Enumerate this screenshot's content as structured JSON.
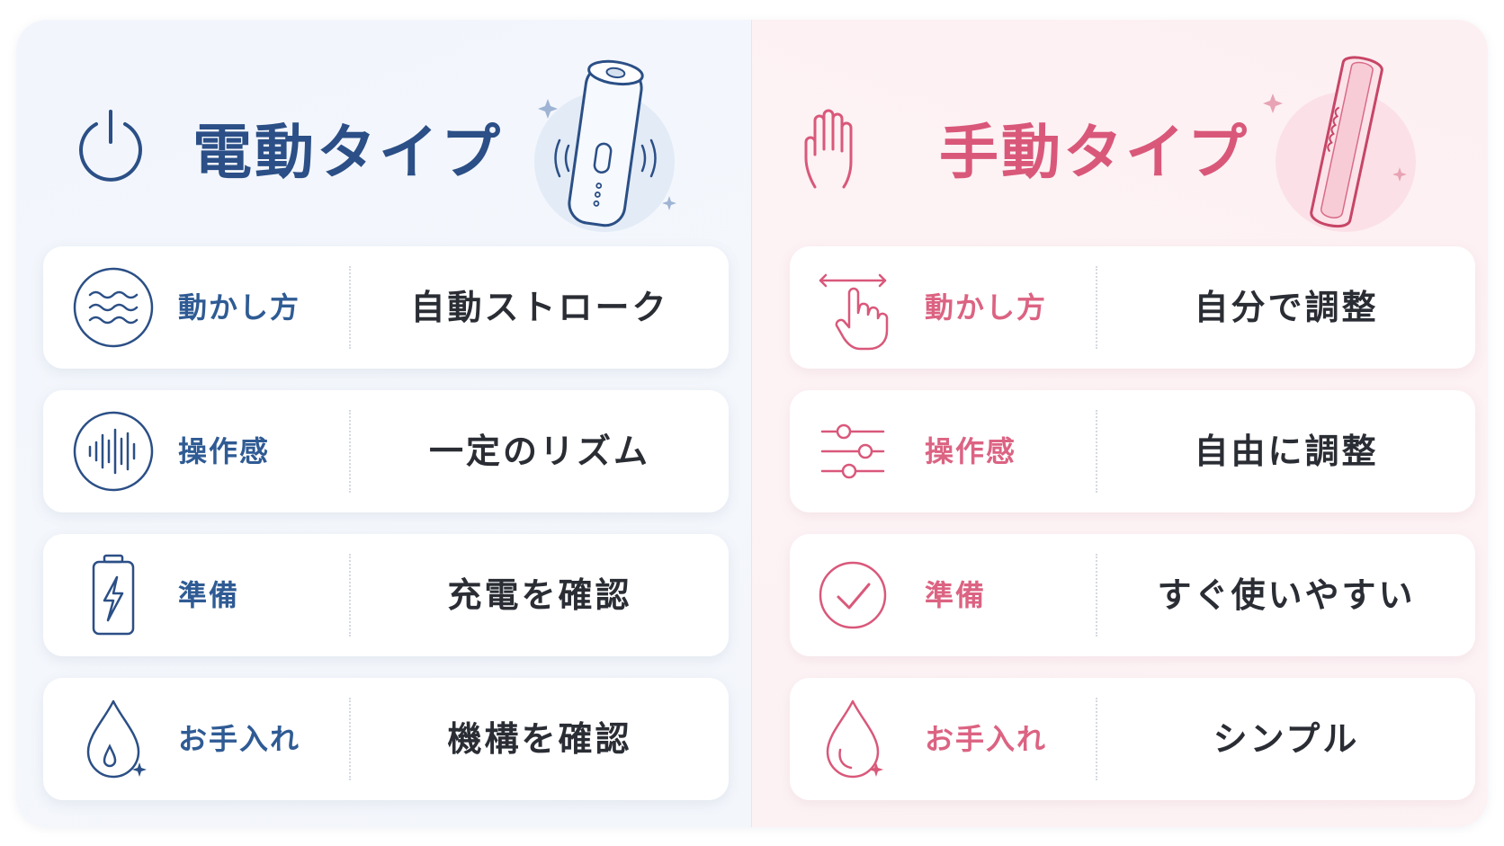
{
  "colors": {
    "electric_accent": "#2b4f86",
    "manual_accent": "#d9587a",
    "value_text": "#2a2d34"
  },
  "electric": {
    "title": "電動タイプ",
    "header_icon": "power-icon",
    "device_icon": "electric-stroker-device-icon",
    "rows": [
      {
        "icon": "wave-lines-icon",
        "label": "動かし方",
        "value": "自動ストローク"
      },
      {
        "icon": "sound-wave-icon",
        "label": "操作感",
        "value": "一定のリズム"
      },
      {
        "icon": "battery-charge-icon",
        "label": "準備",
        "value": "充電を確認"
      },
      {
        "icon": "water-drop-icon",
        "label": "お手入れ",
        "value": "機構を確認"
      }
    ]
  },
  "manual": {
    "title": "手動タイプ",
    "header_icon": "hand-icon",
    "device_icon": "manual-sleeve-device-icon",
    "rows": [
      {
        "icon": "swipe-hand-icon",
        "label": "動かし方",
        "value": "自分で調整"
      },
      {
        "icon": "sliders-icon",
        "label": "操作感",
        "value": "自由に調整"
      },
      {
        "icon": "check-circle-icon",
        "label": "準備",
        "value": "すぐ使いやすい"
      },
      {
        "icon": "water-drop-icon",
        "label": "お手入れ",
        "value": "シンプル"
      }
    ]
  }
}
